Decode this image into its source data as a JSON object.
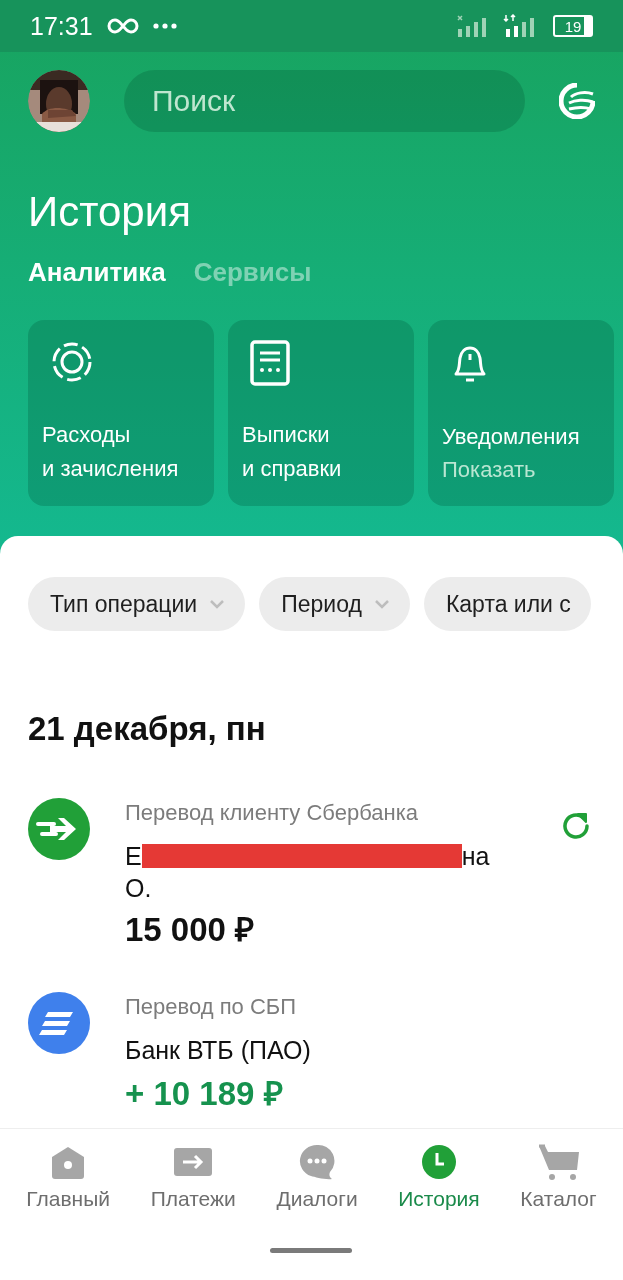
{
  "status_bar": {
    "time": "17:31",
    "battery": "19"
  },
  "header": {
    "search": {
      "placeholder": "Поиск"
    },
    "title": "История",
    "tabs": [
      {
        "label": "Аналитика",
        "selected": true
      },
      {
        "label": "Сервисы",
        "selected": false
      }
    ]
  },
  "tiles": [
    {
      "kind": "expenses",
      "title": "Расходы\nи зачисления"
    },
    {
      "kind": "statements",
      "title": "Выписки\nи справки"
    },
    {
      "kind": "notifications",
      "title": "Уведомления",
      "subtitle": "Показать"
    }
  ],
  "filters": [
    {
      "label": "Тип операции",
      "dropdown": true
    },
    {
      "label": "Период",
      "dropdown": true
    },
    {
      "label": "Карта или с",
      "dropdown": false
    }
  ],
  "date_heading": "21 декабря, пн",
  "transactions": [
    {
      "kind": "sber",
      "incoming": false,
      "type": "Перевод клиенту Сбербанка",
      "name_start": "Е",
      "name_end": "на",
      "name_last": "О.",
      "redacted": true,
      "amount": "15 000 ₽",
      "repeat": true
    },
    {
      "kind": "sbp",
      "incoming": true,
      "type": "Перевод по СБП",
      "name_start": "Банк ВТБ (ПАО)",
      "amount": "+ 10 189 ₽",
      "repeat": false
    }
  ],
  "bottom_nav": [
    {
      "kind": "home",
      "label": "Главный",
      "selected": false
    },
    {
      "kind": "payments",
      "label": "Платежи",
      "selected": false
    },
    {
      "kind": "chat",
      "label": "Диалоги",
      "selected": false
    },
    {
      "kind": "history",
      "label": "История",
      "selected": true
    },
    {
      "kind": "cart",
      "label": "Каталог",
      "selected": false
    }
  ]
}
